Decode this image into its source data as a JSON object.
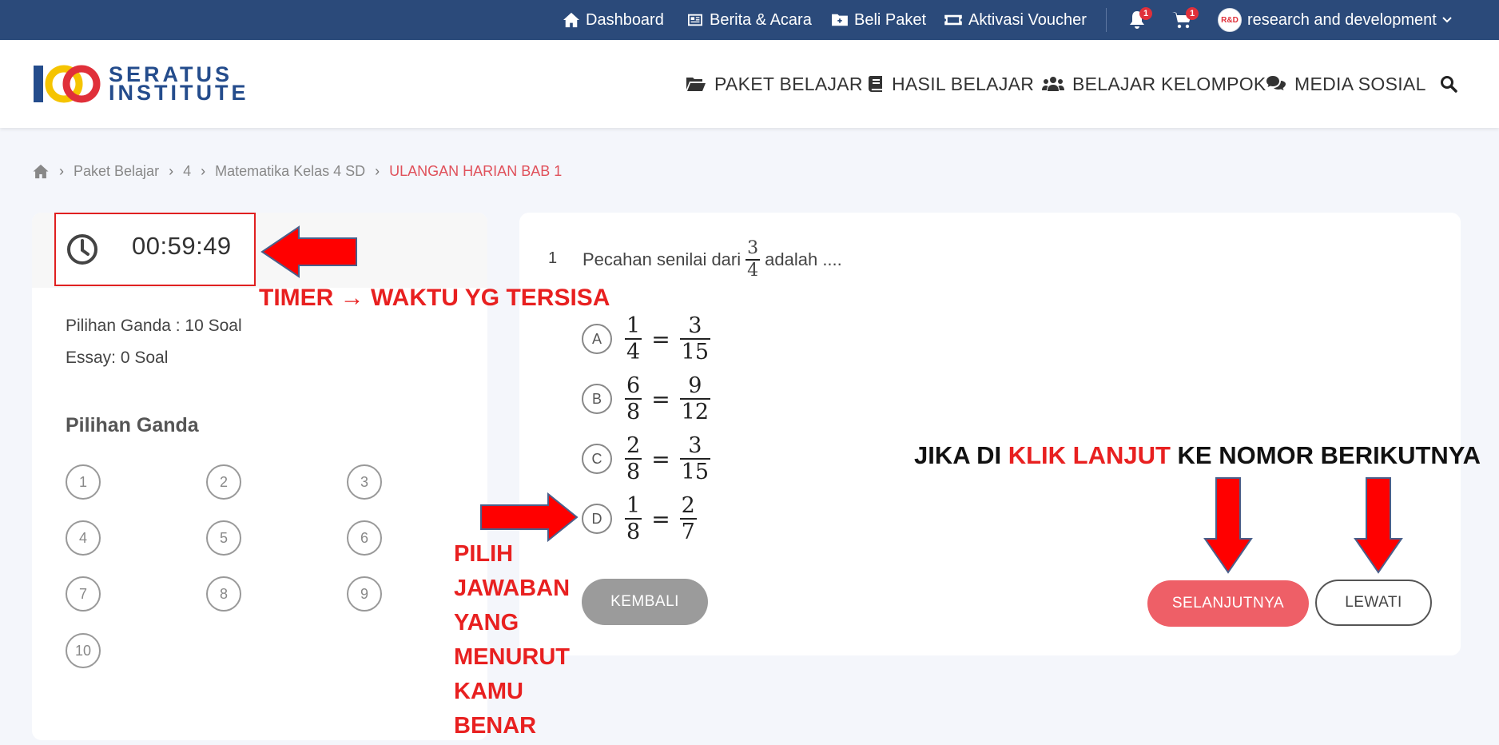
{
  "topbar": {
    "items": [
      {
        "label": "Dashboard",
        "icon": "home-icon"
      },
      {
        "label": "Berita & Acara",
        "icon": "newspaper-icon"
      },
      {
        "label": "Beli Paket",
        "icon": "folder-plus-icon"
      },
      {
        "label": "Aktivasi Voucher",
        "icon": "ticket-icon"
      }
    ],
    "notification_count": "1",
    "cart_count": "1",
    "user_name": "research and development",
    "avatar_text": "R&D"
  },
  "header": {
    "logo_line1": "SERATUS",
    "logo_line2": "INSTITUTE",
    "nav": [
      {
        "label": "PAKET BELAJAR",
        "icon": "folder-open-icon"
      },
      {
        "label": "HASIL BELAJAR",
        "icon": "book-icon"
      },
      {
        "label": "BELAJAR KELOMPOK",
        "icon": "users-icon"
      },
      {
        "label": "MEDIA SOSIAL",
        "icon": "comments-icon"
      }
    ]
  },
  "breadcrumb": {
    "items": [
      "Paket Belajar",
      "4",
      "Matematika Kelas 4 SD"
    ],
    "current": "ULANGAN HARIAN BAB 1"
  },
  "sidebar": {
    "timer": "00:59:49",
    "multiple_choice_info": "Pilihan Ganda : 10 Soal",
    "essay_info": "Essay: 0 Soal",
    "section_title": "Pilihan Ganda",
    "question_numbers": [
      "1",
      "2",
      "3",
      "4",
      "5",
      "6",
      "7",
      "8",
      "9",
      "10"
    ]
  },
  "question": {
    "number": "1",
    "text_before": "Pecahan senilai dari",
    "fraction": {
      "num": "3",
      "den": "4"
    },
    "text_after": "adalah ....",
    "options": [
      {
        "letter": "A",
        "left": {
          "num": "1",
          "den": "4"
        },
        "right": {
          "num": "3",
          "den": "15"
        }
      },
      {
        "letter": "B",
        "left": {
          "num": "6",
          "den": "8"
        },
        "right": {
          "num": "9",
          "den": "12"
        }
      },
      {
        "letter": "C",
        "left": {
          "num": "2",
          "den": "8"
        },
        "right": {
          "num": "3",
          "den": "15"
        }
      },
      {
        "letter": "D",
        "left": {
          "num": "1",
          "den": "8"
        },
        "right": {
          "num": "2",
          "den": "7"
        }
      }
    ],
    "equals": "="
  },
  "buttons": {
    "back": "KEMBALI",
    "next": "SELANJUTNYA",
    "skip": "LEWATI"
  },
  "annotations": {
    "timer": "TIMER → WAKTU YG TERSISA",
    "next_part1": "JIKA DI ",
    "next_part2": "KLIK LANJUT",
    "next_part3": " KE NOMOR BERIKUTNYA",
    "pick_lines": [
      "PILIH",
      "JAWABAN",
      "YANG",
      "MENURUT",
      "KAMU",
      "BENAR"
    ]
  },
  "colors": {
    "topbar": "#2b4a7a",
    "accent": "#ee5f67",
    "annotation_red": "#e82020"
  }
}
